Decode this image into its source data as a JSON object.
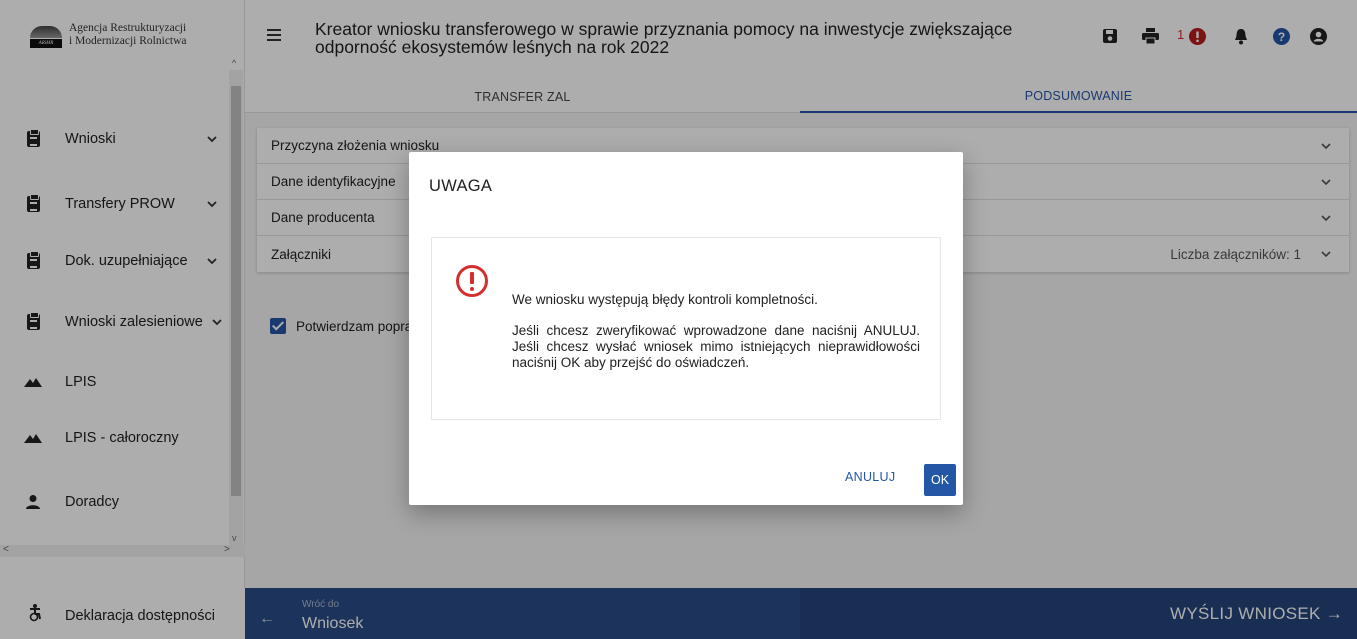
{
  "logo": {
    "line1": "Agencja Restrukturyzacji",
    "line2": "i Modernizacji Rolnictwa",
    "mark": "ARiMR"
  },
  "sidebar": {
    "items": [
      {
        "label": "Wnioski",
        "icon": "clipboard-icon"
      },
      {
        "label": "Transfery PROW",
        "icon": "clipboard-icon"
      },
      {
        "label": "Dok. uzupełniające",
        "icon": "clipboard-icon"
      },
      {
        "label": "Wnioski zalesieniowe",
        "icon": "clipboard-icon"
      },
      {
        "label": "LPIS",
        "icon": "mountain-icon"
      },
      {
        "label": "LPIS - całoroczny",
        "icon": "mountain-icon"
      },
      {
        "label": "Doradcy",
        "icon": "person-icon"
      }
    ],
    "accessibility": "Deklaracja dostępności"
  },
  "header": {
    "title": "Kreator wniosku transferowego w sprawie przyznania pomocy na inwestycje zwiększające odporność ekosystemów leśnych na rok 2022",
    "error_count": "1"
  },
  "tabs": [
    {
      "label": "TRANSFER ZAL"
    },
    {
      "label": "PODSUMOWANIE"
    }
  ],
  "panels": [
    {
      "label": "Przyczyna złożenia wniosku"
    },
    {
      "label": "Dane identyfikacyjne"
    },
    {
      "label": "Dane producenta"
    },
    {
      "label": "Załączniki",
      "extra": "Liczba załączników: 1"
    }
  ],
  "confirm_label": "Potwierdzam poprawność",
  "footer": {
    "back_small": "Wróć do",
    "back_big": "Wniosek",
    "send": "WYŚLIJ WNIOSEK"
  },
  "dialog": {
    "title": "UWAGA",
    "message1": "We wniosku występują błędy kontroli kompletności.",
    "message2": "Jeśli chcesz zweryfikować wprowadzone dane naciśnij ANULUJ. Jeśli chcesz wysłać wniosek mimo istniejących nieprawidłowości naciśnij OK aby przejść do oświadczeń.",
    "cancel": "ANULUJ",
    "ok": "OK"
  },
  "colors": {
    "accent": "#2456a6",
    "footer": "#2a4d86",
    "error": "#d32f2f"
  }
}
